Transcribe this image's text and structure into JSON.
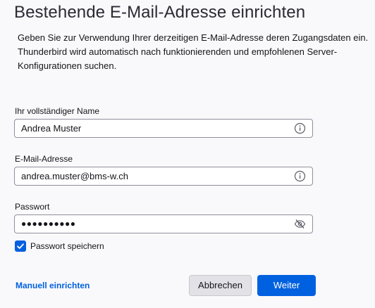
{
  "header": {
    "title": "Bestehende E-Mail-Adresse einrichten",
    "description": "Geben Sie zur Verwendung Ihrer derzeitigen E-Mail-Adresse deren Zugangsdaten ein. Thunderbird wird automatisch nach funktionierenden und empfohlenen Server-Konfigurationen suchen."
  },
  "form": {
    "name": {
      "label": "Ihr vollständiger Name",
      "value": "Andrea Muster",
      "icon": "info-icon"
    },
    "email": {
      "label": "E-Mail-Adresse",
      "value": "andrea.muster@bms-w.ch",
      "icon": "info-icon"
    },
    "password": {
      "label": "Passwort",
      "masked_value": "●●●●●●●●●●",
      "icon": "eye-slash-icon"
    },
    "remember_password": {
      "label": "Passwort speichern",
      "checked": true
    }
  },
  "footer": {
    "manual_link": "Manuell einrichten",
    "cancel_label": "Abbrechen",
    "next_label": "Weiter"
  },
  "colors": {
    "accent": "#0061e0",
    "background": "#f9f9fb",
    "field_border": "#8f8f9d",
    "secondary_button": "#e2e1e6"
  }
}
